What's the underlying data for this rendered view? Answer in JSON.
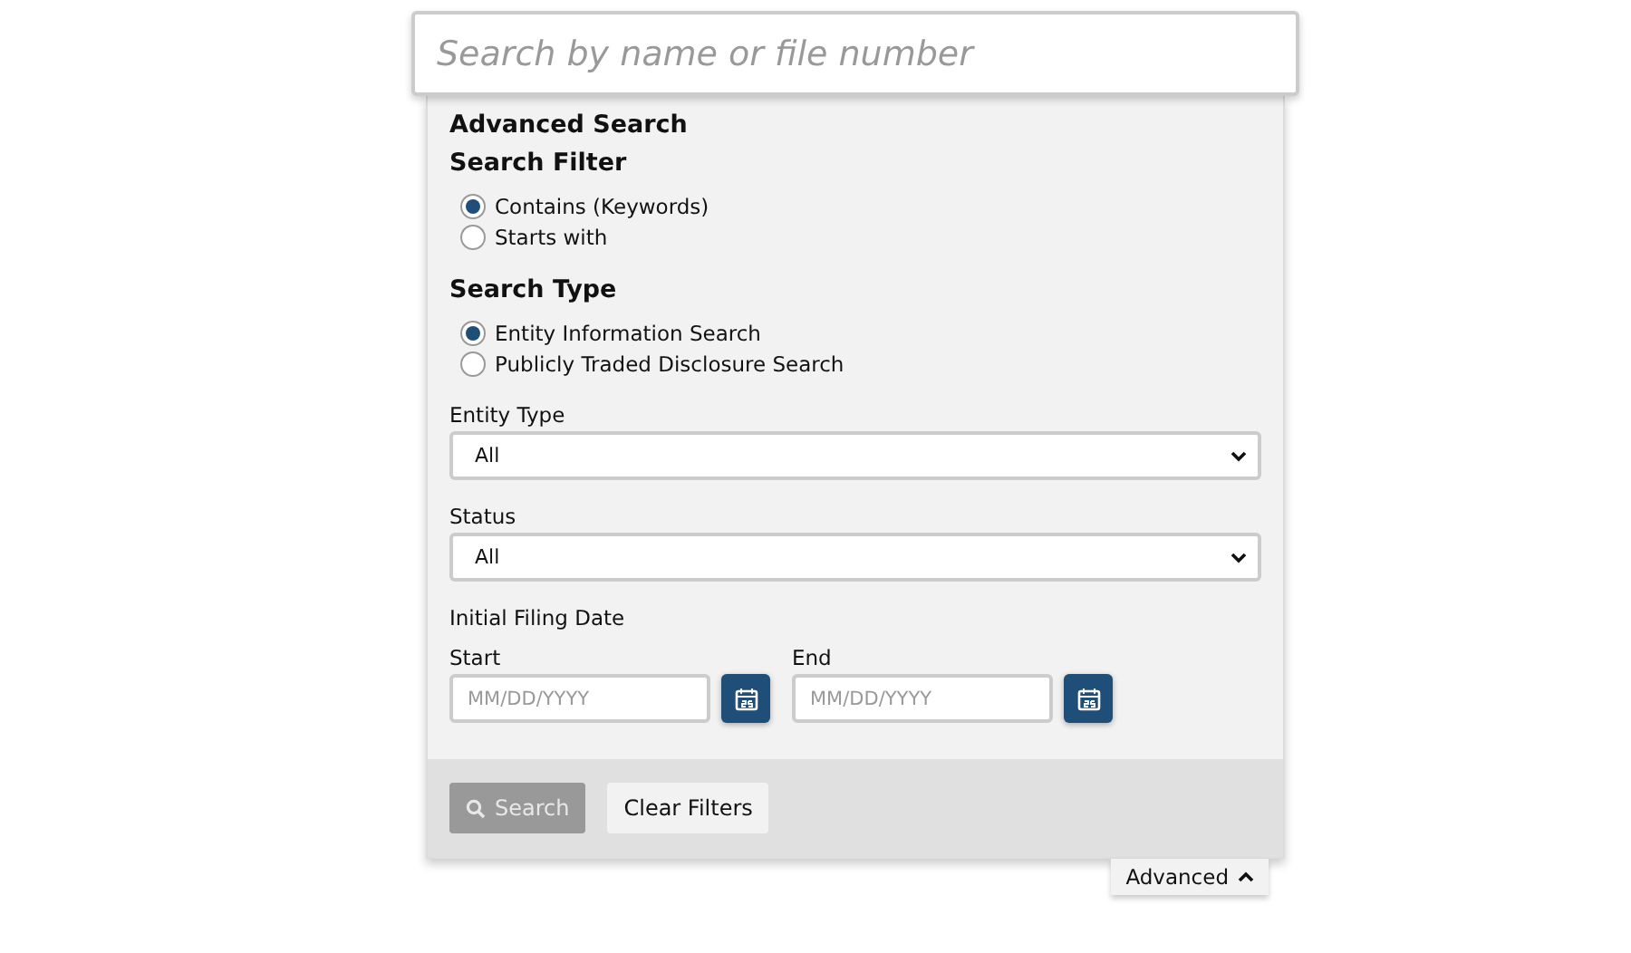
{
  "search": {
    "placeholder": "Search by name or file number"
  },
  "advanced_search": {
    "title": "Advanced Search",
    "groups": [
      {
        "title": "Search Filter",
        "options": [
          {
            "label": "Contains (Keywords)",
            "selected": true
          },
          {
            "label": "Starts with",
            "selected": false
          }
        ]
      },
      {
        "title": "Search Type",
        "options": [
          {
            "label": "Entity Information Search",
            "selected": true
          },
          {
            "label": "Publicly Traded Disclosure Search",
            "selected": false
          }
        ]
      }
    ],
    "selects": [
      {
        "label": "Entity Type",
        "value": "All"
      },
      {
        "label": "Status",
        "value": "All"
      }
    ],
    "date_range": {
      "title": "Initial Filing Date",
      "fields": [
        {
          "label": "Start",
          "placeholder": "MM/DD/YYYY"
        },
        {
          "label": "End",
          "placeholder": "MM/DD/YYYY"
        }
      ]
    },
    "buttons": [
      {
        "label": "Search",
        "kind": "primary",
        "disabled": true
      },
      {
        "label": "Clear Filters",
        "kind": "secondary",
        "disabled": false
      }
    ]
  },
  "toggle": {
    "label": "Advanced",
    "expanded": true
  }
}
